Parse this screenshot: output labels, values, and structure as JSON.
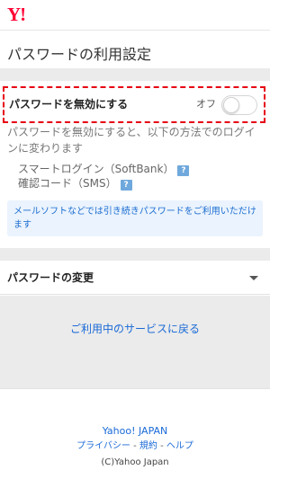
{
  "header": {
    "logo": "Y!"
  },
  "page": {
    "title": "パスワードの利用設定"
  },
  "setting": {
    "label": "パスワードを無効にする",
    "toggle_state": "オフ",
    "toggle_on": false,
    "description": "パスワードを無効にすると、以下の方法でのログインに変わります",
    "methods": [
      {
        "label": "スマートログイン（SoftBank）",
        "icon": "help-icon",
        "icon_glyph": "?"
      },
      {
        "label": "確認コード（SMS）",
        "icon": "help-icon",
        "icon_glyph": "?"
      }
    ],
    "notice": "メールソフトなどでは引き続きパスワードをご利用いただけます",
    "highlight_color": "#e60012"
  },
  "password_change": {
    "label": "パスワードの変更",
    "icon": "chevron-down-icon"
  },
  "back_link": "ご利用中のサービスに戻る",
  "footer": {
    "brand": "Yahoo! JAPAN",
    "links": [
      "プライバシー",
      "規約",
      "ヘルプ"
    ],
    "separator": " - ",
    "copyright": "(C)Yahoo Japan"
  },
  "colors": {
    "brand": "#ff0033",
    "link": "#1a6ad7",
    "background": "#ebebeb"
  }
}
